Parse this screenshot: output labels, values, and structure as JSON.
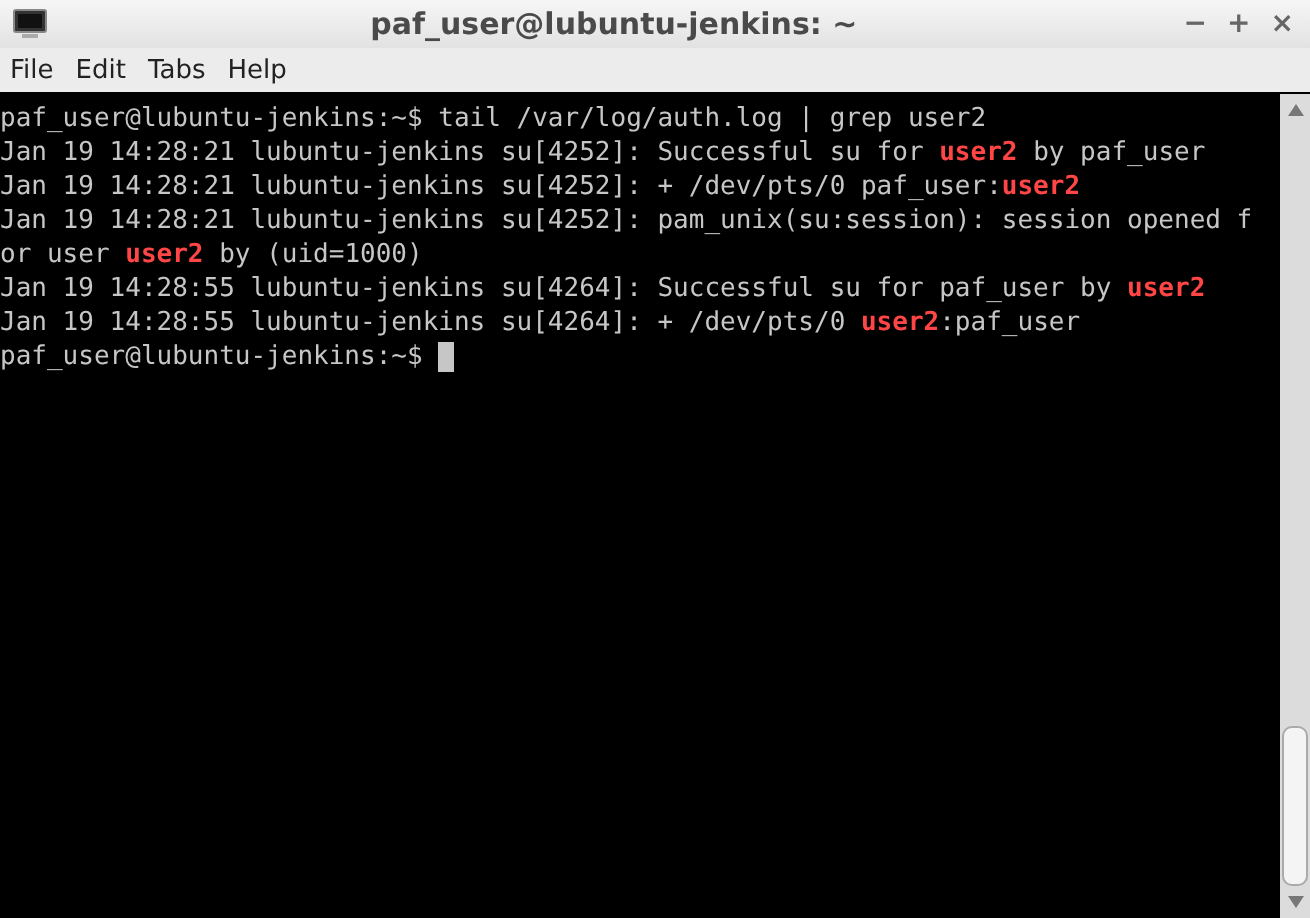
{
  "window": {
    "title": "paf_user@lubuntu-jenkins: ~",
    "controls": [
      "−",
      "+",
      "×"
    ]
  },
  "menu": [
    "File",
    "Edit",
    "Tabs",
    "Help"
  ],
  "terminal": {
    "lines": [
      "paf_user@lubuntu-jenkins:~$ tail /var/log/auth.log | grep user2",
      "Jan 19 14:28:21 lubuntu-jenkins su[4252]: Successful su for **user2** by paf_user",
      "Jan 19 14:28:21 lubuntu-jenkins su[4252]: + /dev/pts/0 paf_user:**user2**",
      "Jan 19 14:28:21 lubuntu-jenkins su[4252]: pam_unix(su:session): session opened f",
      "or user **user2** by (uid=1000)",
      "Jan 19 14:28:55 lubuntu-jenkins su[4264]: Successful su for paf_user by **user2**",
      "Jan 19 14:28:55 lubuntu-jenkins su[4264]: + /dev/pts/0 **user2**:paf_user"
    ],
    "prompt": "paf_user@lubuntu-jenkins:~$"
  }
}
